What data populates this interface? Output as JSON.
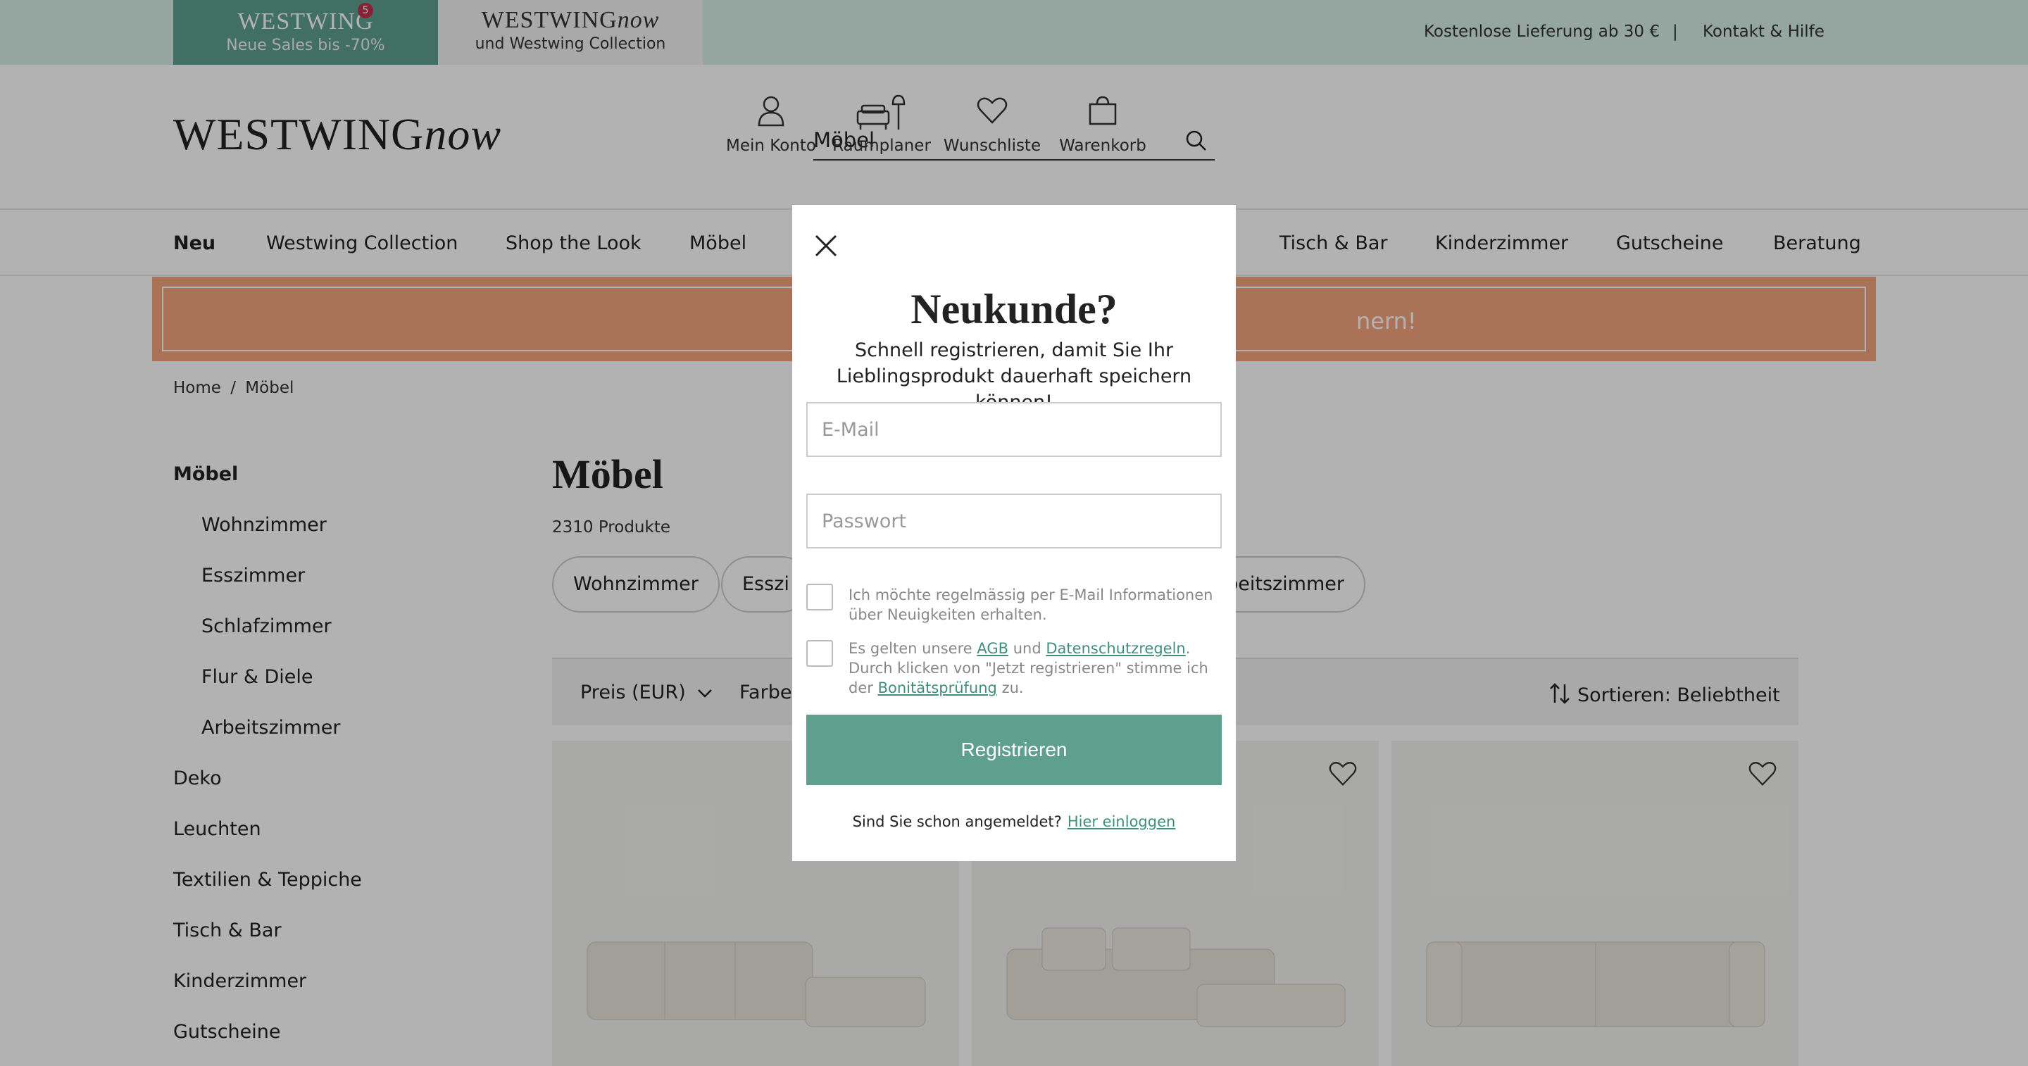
{
  "topbar": {
    "tab_sales_logo": "WESTWING",
    "tab_sales_badge": "5",
    "tab_sales_sub": "Neue Sales bis -70%",
    "tab_now_logo_a": "WESTWING",
    "tab_now_logo_b": "now",
    "tab_now_sub": "und Westwing Collection",
    "delivery": "Kostenlose Lieferung ab 30 €",
    "separator": "|",
    "contact": "Kontakt & Hilfe"
  },
  "header": {
    "brand_a": "WESTWING",
    "brand_b": "now",
    "search_value": "Möbel",
    "icons": [
      {
        "label": "Mein Konto",
        "icon": "user-icon"
      },
      {
        "label": "Raumplaner",
        "icon": "room-planner-icon"
      },
      {
        "label": "Wunschliste",
        "icon": "heart-icon"
      },
      {
        "label": "Warenkorb",
        "icon": "bag-icon"
      }
    ]
  },
  "nav": {
    "items": [
      "Neu",
      "Westwing Collection",
      "Shop the Look",
      "Möbel",
      "Tisch & Bar",
      "Kinderzimmer",
      "Gutscheine",
      "Beratung"
    ]
  },
  "promo": {
    "visible_text": "nern!"
  },
  "breadcrumb": {
    "home": "Home",
    "sep": "/",
    "current": "Möbel"
  },
  "sidebar": {
    "items": [
      {
        "label": "Möbel"
      },
      {
        "label": "Wohnzimmer"
      },
      {
        "label": "Esszimmer"
      },
      {
        "label": "Schlafzimmer"
      },
      {
        "label": "Flur & Diele"
      },
      {
        "label": "Arbeitszimmer"
      },
      {
        "label": "Deko"
      },
      {
        "label": "Leuchten"
      },
      {
        "label": "Textilien & Teppiche"
      },
      {
        "label": "Tisch & Bar"
      },
      {
        "label": "Kinderzimmer"
      },
      {
        "label": "Gutscheine"
      }
    ]
  },
  "main": {
    "title": "Möbel",
    "count": "2310 Produkte",
    "chips": [
      "Wohnzimmer",
      "Esszi",
      "rbeitszimmer"
    ],
    "filters": {
      "price": "Preis (EUR)",
      "color": "Farbe",
      "sort": "Sortieren: Beliebtheit"
    }
  },
  "modal": {
    "title": "Neukunde?",
    "subtitle": "Schnell registrieren, damit Sie Ihr Lieblingsprodukt dauerhaft speichern können!",
    "email_placeholder": "E-Mail",
    "password_placeholder": "Passwort",
    "newsletter_text": "Ich möchte regelmässig per E-Mail Informationen über Neuigkeiten erhalten.",
    "terms_prefix": "Es gelten unsere",
    "terms_agb": "AGB",
    "terms_and": "und",
    "terms_privacy": "Datenschutzregeln",
    "terms_middle": ". Durch klicken von \"Jetzt registrieren\" stimme ich der",
    "terms_credit": "Bonitätsprüfung",
    "terms_suffix": "zu.",
    "button": "Registrieren",
    "login_question": "Sind Sie schon angemeldet?",
    "login_link": "Hier einloggen"
  },
  "colors": {
    "teal": "#5f9f8e",
    "mint": "#d6ece6",
    "promo": "#f4a57d"
  }
}
